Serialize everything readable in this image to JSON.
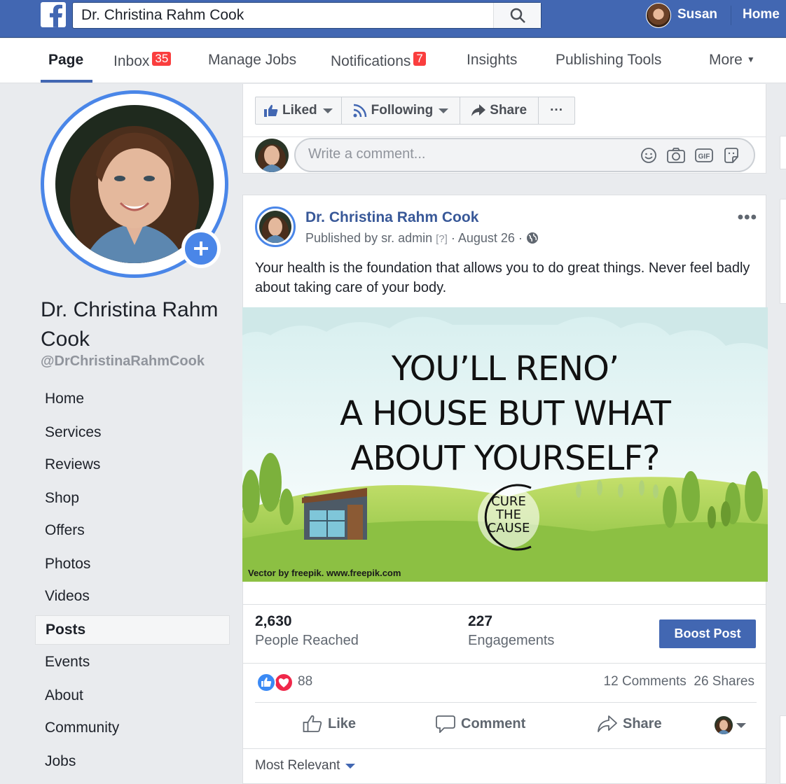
{
  "topbar": {
    "search_value": "Dr. Christina Rahm Cook",
    "user_name": "Susan",
    "home_label": "Home"
  },
  "tabs": [
    {
      "label": "Page",
      "badge": ""
    },
    {
      "label": "Inbox",
      "badge": "35"
    },
    {
      "label": "Manage Jobs",
      "badge": ""
    },
    {
      "label": "Notifications",
      "badge": "7"
    },
    {
      "label": "Insights",
      "badge": ""
    },
    {
      "label": "Publishing Tools",
      "badge": ""
    },
    {
      "label": "More",
      "badge": ""
    }
  ],
  "profile": {
    "name": "Dr. Christina Rahm Cook",
    "handle": "@DrChristinaRahmCook"
  },
  "sidebar": {
    "items": [
      "Home",
      "Services",
      "Reviews",
      "Shop",
      "Offers",
      "Photos",
      "Videos",
      "Posts",
      "Events",
      "About",
      "Community",
      "Jobs"
    ],
    "active": "Posts"
  },
  "page_actions": {
    "liked": "Liked",
    "following": "Following",
    "share": "Share",
    "more": "···"
  },
  "comment_box": {
    "placeholder": "Write a comment..."
  },
  "post": {
    "author": "Dr. Christina Rahm Cook",
    "published_by": "Published by sr. admin",
    "help": "[?]",
    "date": "· August 26 ·",
    "text": "Your health is the foundation that allows you to do great things. Never feel badly about taking care of your body.",
    "image": {
      "line1": "YOU’LL RENO’",
      "line2": "A HOUSE BUT WHAT",
      "line3": "ABOUT YOURSELF?",
      "logo_line1": "CURE",
      "logo_line2": "THE",
      "logo_line3": "CAUSE",
      "credit": "Vector by freepik. www.freepik.com"
    },
    "people_reached": "2,630",
    "people_reached_label": "People Reached",
    "engagements": "227",
    "engagements_label": "Engagements",
    "boost_label": "Boost Post",
    "reactions": "88",
    "comments": "12 Comments",
    "shares": "26 Shares",
    "like_label": "Like",
    "comment_label": "Comment",
    "share_label": "Share",
    "sort_label": "Most Relevant"
  },
  "colors": {
    "brand_blue": "#4267b2",
    "badge_red": "#fa3e3e",
    "ring_blue": "#4a86e8"
  }
}
